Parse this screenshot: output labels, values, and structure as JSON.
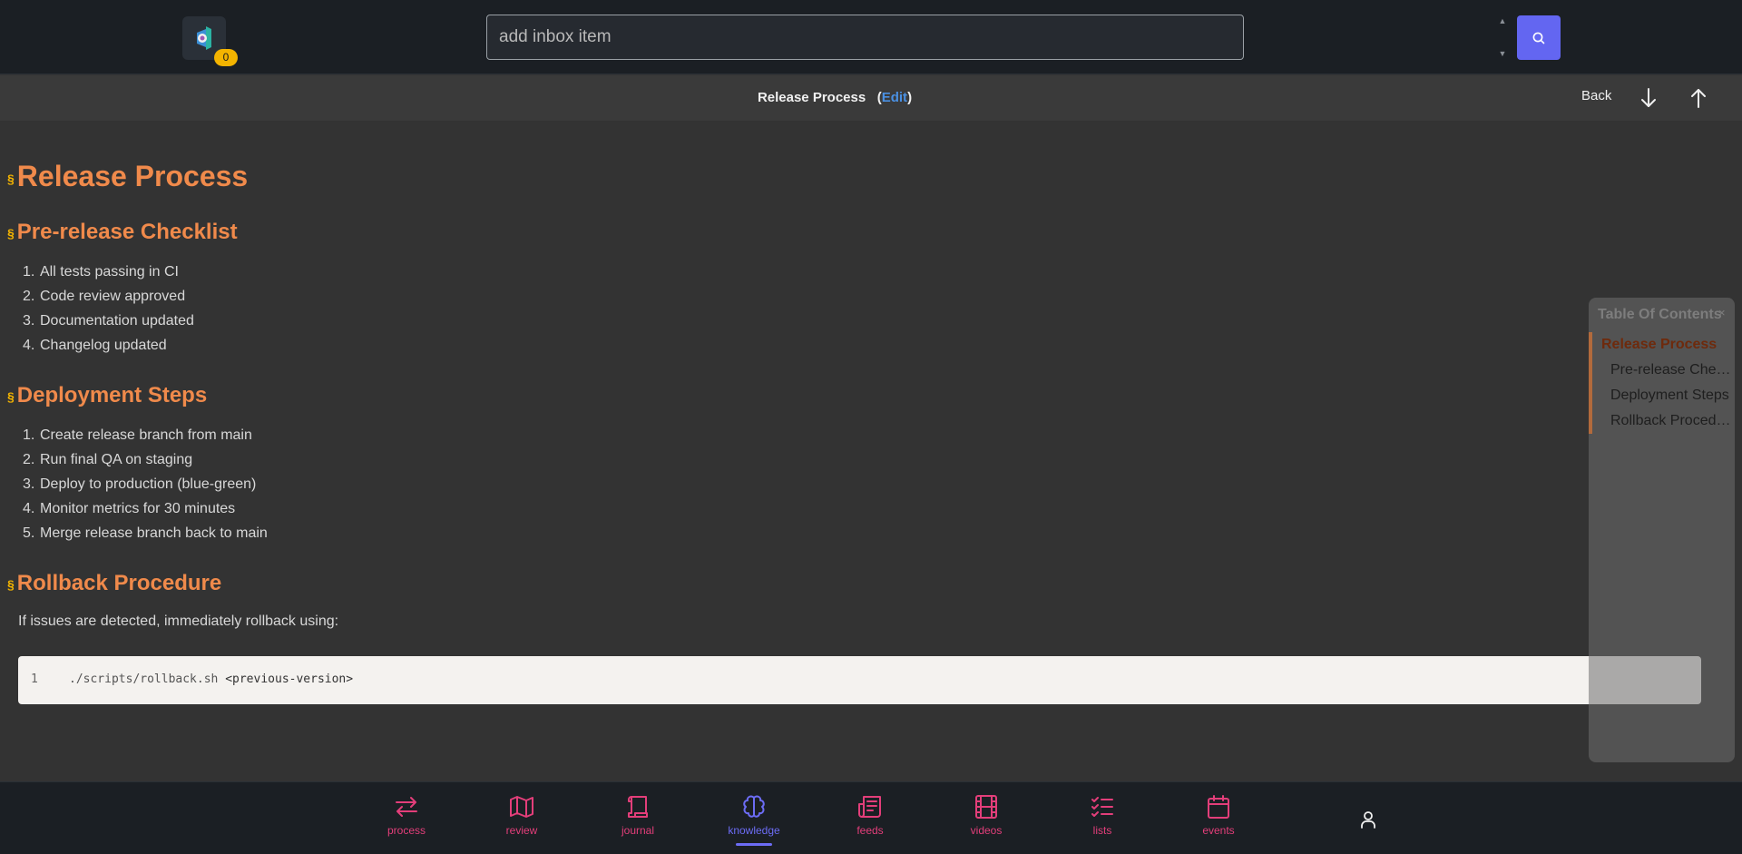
{
  "header": {
    "badge_count": "0",
    "search_placeholder": "add inbox item"
  },
  "subheader": {
    "title": "Release Process",
    "open_paren": "(",
    "edit_label": "Edit",
    "close_paren": ")",
    "back_label": "Back"
  },
  "document": {
    "section_marker": "§",
    "title": "Release Process",
    "sections": [
      {
        "heading": "Pre-release Checklist",
        "items": [
          "All tests passing in CI",
          "Code review approved",
          "Documentation updated",
          "Changelog updated"
        ]
      },
      {
        "heading": "Deployment Steps",
        "items": [
          "Create release branch from main",
          "Run final QA on staging",
          "Deploy to production (blue-green)",
          "Monitor metrics for 30 minutes",
          "Merge release branch back to main"
        ]
      },
      {
        "heading": "Rollback Procedure",
        "paragraph": "If issues are detected, immediately rollback using:",
        "code": {
          "line_number": "1",
          "command": "./scripts/rollback.sh",
          "argument": "<previous-version>"
        }
      }
    ]
  },
  "toc": {
    "title": "Table Of Contents",
    "close_glyph": "×",
    "items": [
      "Release Process",
      "Pre-release Checklist",
      "Deployment Steps",
      "Rollback Procedure"
    ]
  },
  "nav": {
    "items": [
      "process",
      "review",
      "journal",
      "knowledge",
      "feeds",
      "videos",
      "lists",
      "events"
    ],
    "active": "knowledge"
  },
  "colors": {
    "accent": "#6366f1",
    "heading": "#f08a4b",
    "nav": "#e33e7a",
    "badge": "#f4b400"
  }
}
